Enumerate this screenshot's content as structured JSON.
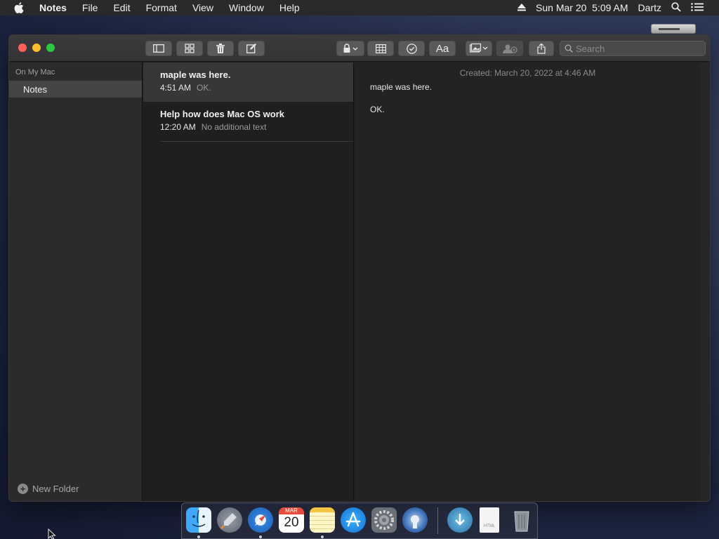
{
  "menubar": {
    "app_name": "Notes",
    "menus": [
      "File",
      "Edit",
      "Format",
      "View",
      "Window",
      "Help"
    ],
    "datetime": "Sun Mar 20  5:09 AM",
    "user": "Dartz"
  },
  "toolbar": {
    "buttons": [
      "sidebar-toggle-icon",
      "gallery-icon",
      "trash-icon",
      "compose-icon",
      "lock-icon",
      "table-icon",
      "checklist-icon",
      "format-icon",
      "media-icon",
      "collaborate-icon",
      "share-icon"
    ],
    "format_label": "Aa",
    "search_placeholder": "Search"
  },
  "sidebar": {
    "section": "On My Mac",
    "folders": [
      {
        "label": "Notes",
        "selected": true
      }
    ],
    "new_folder_label": "New Folder"
  },
  "notes": [
    {
      "title": "maple was here.",
      "time": "4:51 AM",
      "preview": "OK.",
      "selected": true
    },
    {
      "title": "Help how does Mac OS work",
      "time": "12:20 AM",
      "preview": "No additional text",
      "selected": false
    }
  ],
  "editor": {
    "created": "Created: March 20, 2022 at 4:46 AM",
    "lines": [
      "maple was here.",
      "OK."
    ]
  },
  "dock": {
    "apps": [
      "finder-icon",
      "launchpad-icon",
      "safari-icon",
      "calendar-icon",
      "notes-icon",
      "app-store-icon",
      "system-preferences-icon",
      "utility-icon",
      "downloads-icon",
      "html-file-icon",
      "trash-icon"
    ],
    "calendar_month": "MAR",
    "calendar_day": "20",
    "html_label": "HTML"
  }
}
